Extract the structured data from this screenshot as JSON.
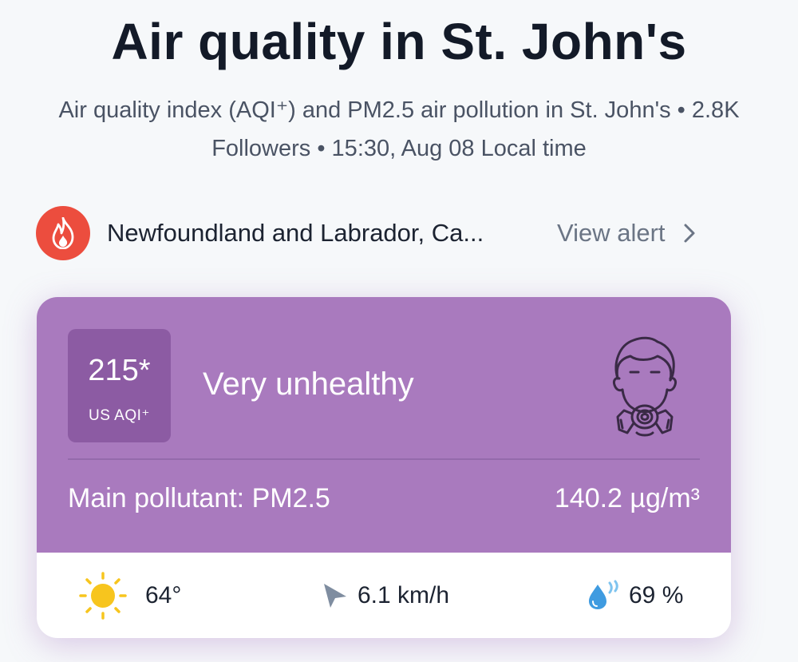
{
  "header": {
    "title": "Air quality in St. John's",
    "subtitle_line1": "Air quality index (AQI⁺) and PM2.5 air pollution in St. John's • 2.8K",
    "subtitle_line2": "Followers • 15:30, Aug 08 Local time"
  },
  "alert": {
    "icon": "fire-icon",
    "location": "Newfoundland and Labrador, Ca...",
    "action_label": "View alert",
    "chevron_icon": "chevron-right-icon",
    "color": "#ec4d3e"
  },
  "aqi_card": {
    "aqi_value": "215*",
    "aqi_unit": "US AQI⁺",
    "status": "Very unhealthy",
    "status_icon": "gas-mask-person-icon",
    "main_pollutant_label": "Main pollutant: PM2.5",
    "concentration": "140.2 µg/m³",
    "color": "#a97abe",
    "box_color": "#8c5ba3"
  },
  "weather": {
    "temperature": "64°",
    "temperature_icon": "sun-icon",
    "wind": "6.1 km/h",
    "wind_icon": "wind-direction-arrow-icon",
    "humidity": "69 %",
    "humidity_icon": "humidity-drop-icon"
  }
}
